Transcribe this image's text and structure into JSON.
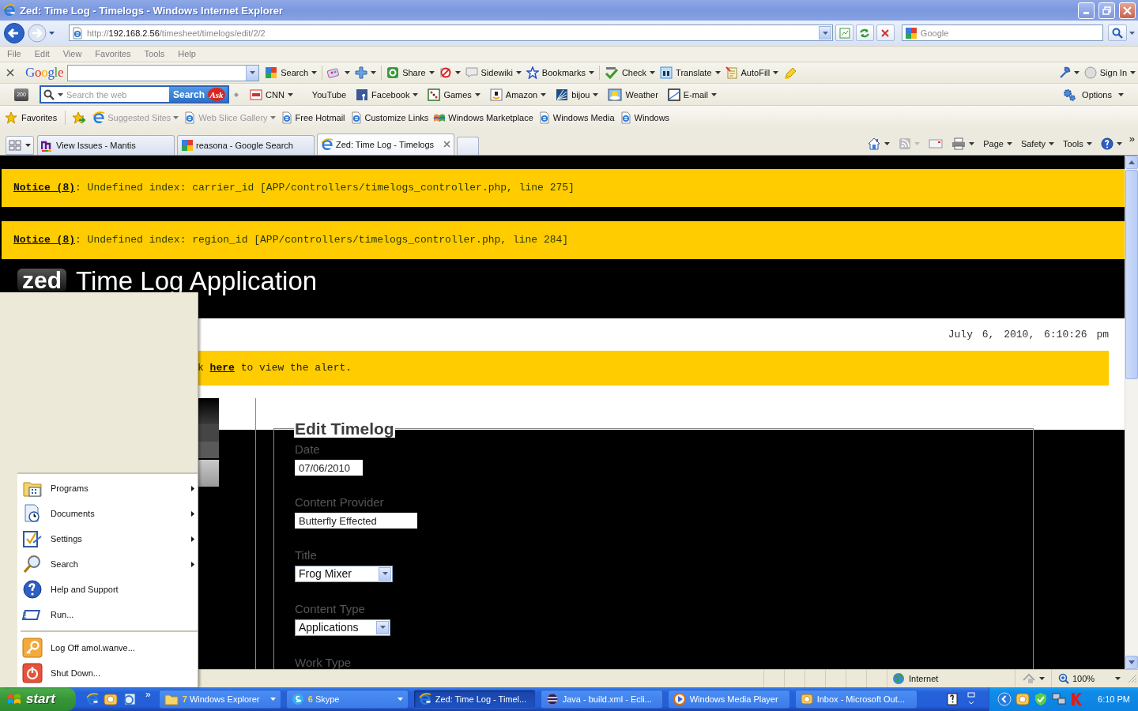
{
  "window": {
    "title": "Zed: Time Log - Timelogs - Windows Internet Explorer"
  },
  "address_bar": {
    "scheme": "http://",
    "host": "192.168.2.56",
    "path": "/timesheet/timelogs/edit/2/2"
  },
  "search_box": {
    "placeholder": "Google"
  },
  "menu_bar": [
    "File",
    "Edit",
    "View",
    "Favorites",
    "Tools",
    "Help"
  ],
  "google_toolbar": {
    "logo": "Google",
    "items": [
      {
        "label": "Search",
        "dropdown": true
      },
      {
        "dropdown": true
      },
      {
        "dropdown": true
      },
      {
        "label": "Share",
        "dropdown": true
      },
      {
        "dropdown": true
      },
      {
        "label": "Sidewiki",
        "dropdown": true
      },
      {
        "label": "Bookmarks",
        "dropdown": true
      },
      {
        "label": "Check",
        "dropdown": true
      },
      {
        "label": "Translate",
        "dropdown": true
      },
      {
        "label": "AutoFill",
        "dropdown": true
      },
      {
        "dropdown": false
      }
    ],
    "sign_in": "Sign In"
  },
  "ask_toolbar": {
    "badge": "200",
    "placeholder": "Search the web",
    "button": "Search",
    "logo": "Ask",
    "items": [
      {
        "label": "CNN",
        "dropdown": true
      },
      {
        "label": "YouTube",
        "dropdown": false
      },
      {
        "label": "Facebook",
        "dropdown": true
      },
      {
        "label": "Games",
        "dropdown": true
      },
      {
        "label": "Amazon",
        "dropdown": true
      },
      {
        "label": "bijou",
        "dropdown": true
      },
      {
        "label": "Weather",
        "dropdown": false
      },
      {
        "label": "E-mail",
        "dropdown": true
      }
    ],
    "options": "Options"
  },
  "favorites_bar": {
    "label": "Favorites",
    "links": [
      {
        "label": "Suggested Sites",
        "dropdown": true,
        "disabled": true
      },
      {
        "label": "Web Slice Gallery",
        "dropdown": true,
        "disabled": true
      },
      {
        "label": "Free Hotmail",
        "dropdown": false,
        "disabled": false
      },
      {
        "label": "Customize Links",
        "dropdown": false,
        "disabled": false
      },
      {
        "label": "Windows Marketplace",
        "dropdown": false,
        "disabled": false
      },
      {
        "label": "Windows Media",
        "dropdown": false,
        "disabled": false
      },
      {
        "label": "Windows",
        "dropdown": false,
        "disabled": false
      }
    ]
  },
  "tabs": [
    {
      "label": "View Issues - Mantis",
      "selected": false
    },
    {
      "label": "reasona - Google Search",
      "selected": false
    },
    {
      "label": "Zed: Time Log - Timelogs",
      "selected": true
    }
  ],
  "command_bar": {
    "menus": [
      "Page",
      "Safety",
      "Tools"
    ],
    "more": "»"
  },
  "page": {
    "notices": [
      {
        "label": "Notice (8)",
        "message": ": Undefined index: carrier_id [APP/controllers/timelogs_controller.php, line 275]"
      },
      {
        "label": "Notice (8)",
        "message": ": Undefined index: region_id [APP/controllers/timelogs_controller.php, line 284]"
      }
    ],
    "logo": "zed",
    "title": "Time Log Application",
    "datetime": "July 6, 2010, 6:10:26 pm",
    "alert": {
      "before": "k",
      "link": "here",
      "after": "to view the alert."
    },
    "form": {
      "legend": "Edit Timelog",
      "fields": [
        {
          "label": "Date",
          "kind": "text",
          "value": "07/06/2010"
        },
        {
          "label": "Content Provider",
          "kind": "text",
          "value": "Butterfly Effected"
        },
        {
          "label": "Title",
          "kind": "select",
          "value": "Frog Mixer"
        },
        {
          "label": "Content Type",
          "kind": "select",
          "value": "Applications"
        },
        {
          "label": "Work Type",
          "kind": "label"
        }
      ]
    }
  },
  "status_bar": {
    "zone": "Internet",
    "zoom": "100%"
  },
  "start_menu": {
    "items": [
      {
        "label": "Programs",
        "submenu": true
      },
      {
        "label": "Documents",
        "submenu": true
      },
      {
        "label": "Settings",
        "submenu": true
      },
      {
        "label": "Search",
        "submenu": true
      },
      {
        "label": "Help and Support",
        "submenu": false
      },
      {
        "label": "Run...",
        "submenu": false
      }
    ],
    "session": [
      "Log Off amol.wanve...",
      "Shut Down..."
    ]
  },
  "taskbar": {
    "start": "start",
    "more": "»",
    "tasks": [
      {
        "count": "7",
        "label": "Windows Explorer",
        "group": true,
        "selected": false
      },
      {
        "count": "6",
        "label": "Skype",
        "group": true,
        "selected": false
      },
      {
        "label": "Zed: Time Log - Timel...",
        "group": false,
        "selected": true
      },
      {
        "label": "Java - build.xml - Ecli...",
        "group": false,
        "selected": false
      },
      {
        "label": "Windows Media Player",
        "group": false,
        "selected": false
      },
      {
        "label": "Inbox - Microsoft Out...",
        "group": false,
        "selected": false
      }
    ],
    "clock": "6:10 PM"
  }
}
